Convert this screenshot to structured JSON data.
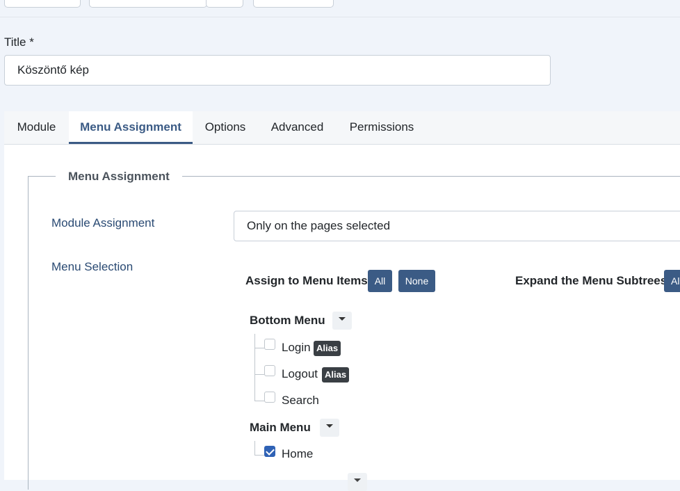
{
  "form": {
    "title_label": "Title *",
    "title_value": "Köszöntő kép"
  },
  "tabs": [
    {
      "label": "Module"
    },
    {
      "label": "Menu Assignment"
    },
    {
      "label": "Options"
    },
    {
      "label": "Advanced"
    },
    {
      "label": "Permissions"
    }
  ],
  "menu_assignment": {
    "legend": "Menu Assignment",
    "module_assignment_label": "Module Assignment",
    "module_assignment_value": "Only on the pages selected",
    "menu_selection_label": "Menu Selection",
    "assign_items_label": "Assign to Menu Items",
    "all_label": "All",
    "none_label": "None",
    "expand_subtrees_label": "Expand the Menu Subtrees",
    "expand_all_label": "Al"
  },
  "menus": [
    {
      "title": "Bottom Menu",
      "items": [
        {
          "label": "Login",
          "badge": "Alias",
          "checked": false
        },
        {
          "label": "Logout",
          "badge": "Alias",
          "checked": false
        },
        {
          "label": "Search",
          "badge": "",
          "checked": false
        }
      ]
    },
    {
      "title": "Main Menu",
      "items": [
        {
          "label": "Home",
          "badge": "",
          "checked": true
        }
      ]
    }
  ],
  "colors": {
    "accent": "#3b5b85",
    "checkbox_checked": "#2f62b5",
    "badge_bg": "#3a3f44"
  }
}
